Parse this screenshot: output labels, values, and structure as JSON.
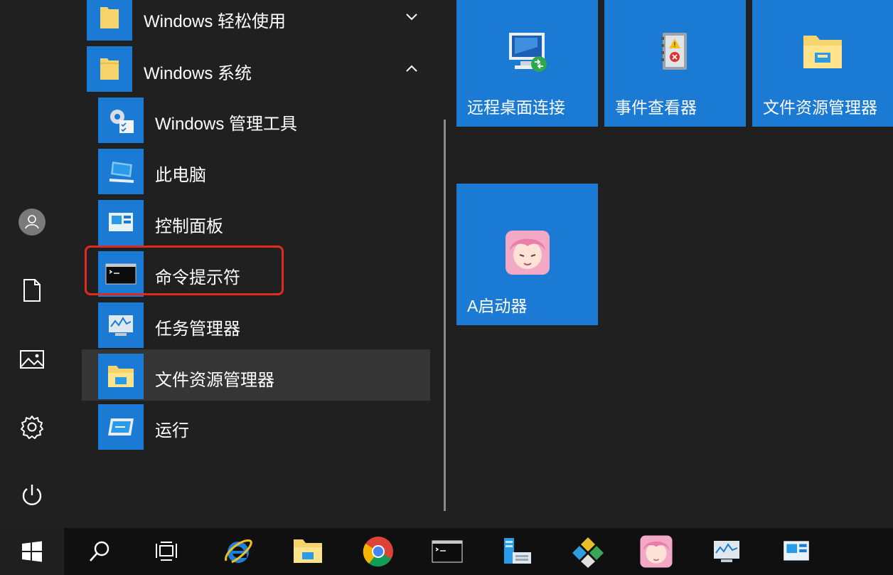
{
  "app_list": {
    "groups": [
      {
        "label": "Windows 轻松使用",
        "state": "collapsed"
      },
      {
        "label": "Windows 系统",
        "state": "expanded"
      }
    ],
    "items": [
      {
        "label": "Windows 管理工具",
        "icon": "admin-tools-icon"
      },
      {
        "label": "此电脑",
        "icon": "this-pc-icon"
      },
      {
        "label": "控制面板",
        "icon": "control-panel-icon"
      },
      {
        "label": "命令提示符",
        "icon": "command-prompt-icon",
        "highlighted": true
      },
      {
        "label": "任务管理器",
        "icon": "task-manager-icon"
      },
      {
        "label": "文件资源管理器",
        "icon": "file-explorer-icon",
        "hovered": true
      },
      {
        "label": "运行",
        "icon": "run-icon"
      }
    ]
  },
  "rail": {
    "items": [
      "user-icon",
      "documents-icon",
      "pictures-icon",
      "settings-icon",
      "power-icon"
    ]
  },
  "tiles": [
    {
      "label": "远程桌面连接",
      "icon": "remote-desktop-icon"
    },
    {
      "label": "事件查看器",
      "icon": "event-viewer-icon"
    },
    {
      "label": "文件资源管理器",
      "icon": "file-explorer-icon"
    },
    {
      "label": "A启动器",
      "icon": "anime-launcher-icon"
    }
  ],
  "taskbar": {
    "items": [
      "start-icon",
      "search-icon",
      "task-view-icon",
      "internet-explorer-icon",
      "file-explorer-icon",
      "chrome-icon",
      "command-prompt-icon",
      "server-manager-icon",
      "puzzle-app-icon",
      "anime-launcher-icon",
      "task-manager-icon",
      "control-panel-icon"
    ]
  },
  "colors": {
    "accent": "#1a7ad4",
    "background": "#202020",
    "highlight_border": "#e02a1d",
    "taskbar": "#101010"
  }
}
